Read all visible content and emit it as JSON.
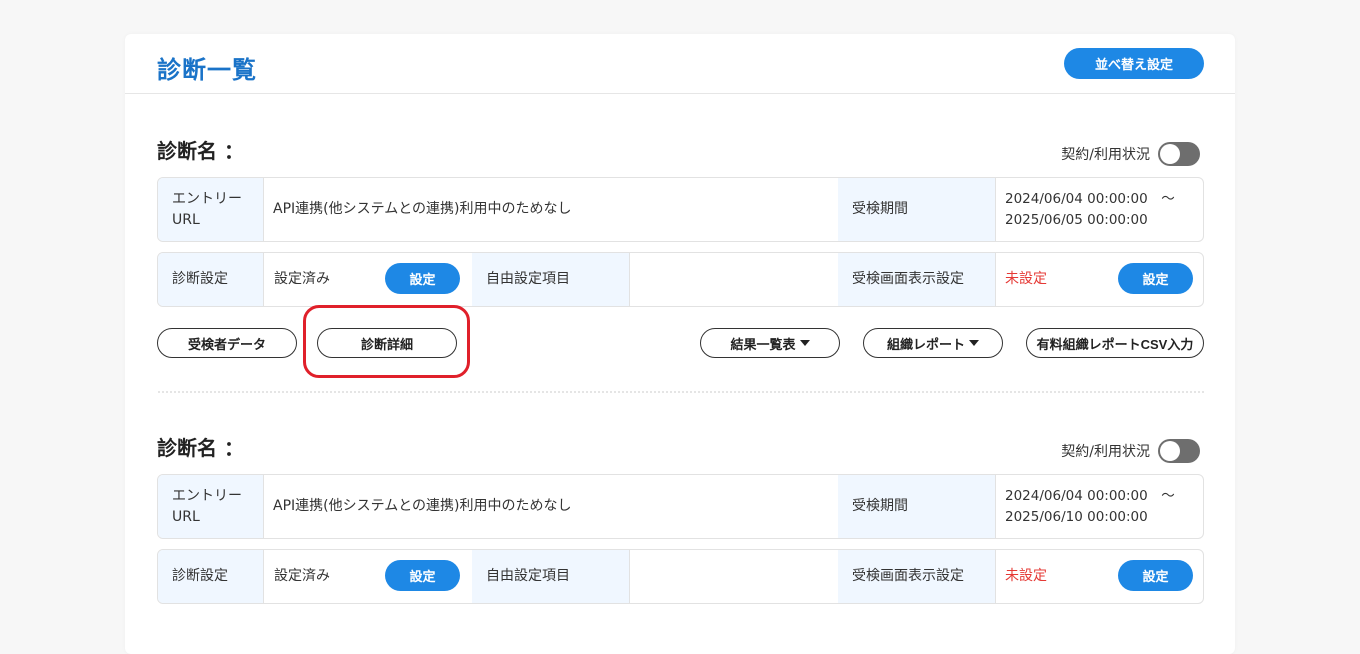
{
  "header": {
    "title": "診断一覧",
    "sort_button_label": "並べ替え設定"
  },
  "sections": [
    {
      "title": "診断名 ：",
      "status_label": "契約/利用状況",
      "entry_url_label": "エントリー\nURL",
      "entry_url_value": "API連携(他システムとの連携)利用中のためなし",
      "period_label": "受検期間",
      "period_line1": "2024/06/04 00:00:00　～",
      "period_line2": "2025/06/05 00:00:00",
      "diag_setting_label": "診断設定",
      "diag_setting_value": "設定済み",
      "setting_button_label": "設定",
      "free_item_label": "自由設定項目",
      "free_item_value": "",
      "screen_setting_label": "受検画面表示設定",
      "screen_setting_value": "未設定",
      "screen_setting_button_label": "設定",
      "actions": {
        "examinee_data": "受検者データ",
        "diag_detail": "診断詳細",
        "result_list": "結果一覧表",
        "org_report": "組織レポート",
        "paid_csv": "有料組織レポートCSV入力"
      }
    },
    {
      "title": "診断名 ：",
      "status_label": "契約/利用状況",
      "entry_url_label": "エントリー\nURL",
      "entry_url_value": "API連携(他システムとの連携)利用中のためなし",
      "period_label": "受検期間",
      "period_line1": "2024/06/04 00:00:00　～",
      "period_line2": "2025/06/10 00:00:00",
      "diag_setting_label": "診断設定",
      "diag_setting_value": "設定済み",
      "setting_button_label": "設定",
      "free_item_label": "自由設定項目",
      "free_item_value": "",
      "screen_setting_label": "受検画面表示設定",
      "screen_setting_value": "未設定",
      "screen_setting_button_label": "設定"
    }
  ],
  "colors": {
    "accent": "#1e88e5",
    "title": "#1a73c8",
    "warning": "#e53935",
    "highlight": "#e0202a",
    "label_bg": "#f0f7ff"
  }
}
